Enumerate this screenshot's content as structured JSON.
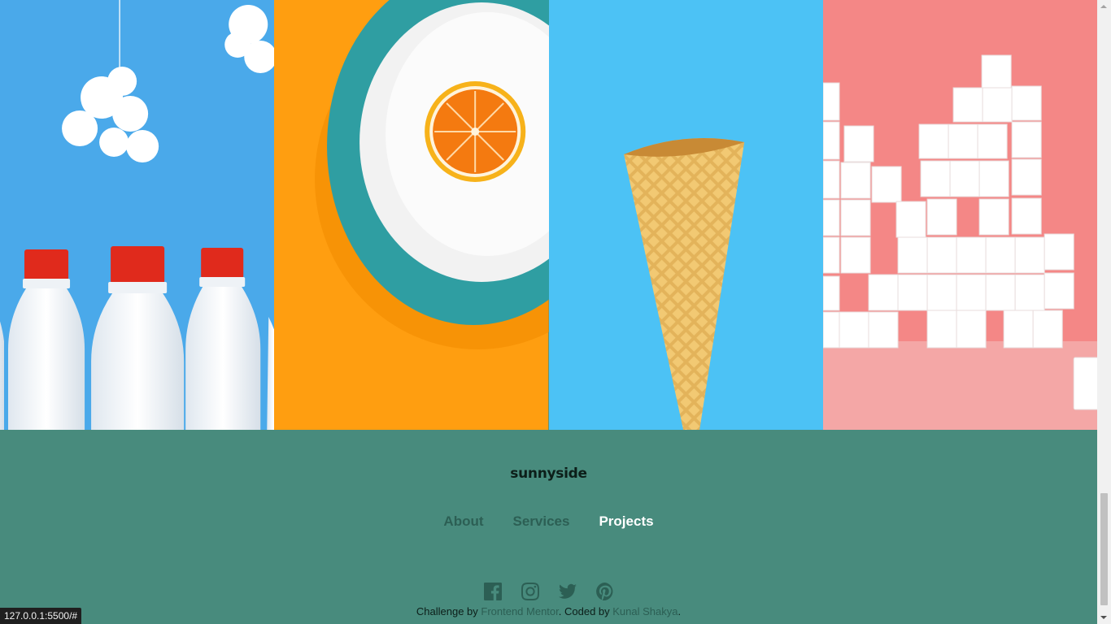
{
  "gallery": {
    "images": [
      {
        "name": "milk-bottles-image",
        "background": "#4aa9ea"
      },
      {
        "name": "orange-plate-image",
        "background": "#ff9e10"
      },
      {
        "name": "ice-cream-cone-image",
        "background": "#4cc2f5"
      },
      {
        "name": "sugar-cubes-image",
        "background": "#f48786"
      }
    ]
  },
  "footer": {
    "logo": "sunnyside",
    "nav": [
      {
        "label": "About",
        "active": false
      },
      {
        "label": "Services",
        "active": false
      },
      {
        "label": "Projects",
        "active": true
      }
    ],
    "social_icons": [
      "facebook-icon",
      "instagram-icon",
      "twitter-icon",
      "pinterest-icon"
    ],
    "credit": {
      "prefix": "Challenge by ",
      "challenge_link": "Frontend Mentor",
      "middle": ". Coded by ",
      "author_link": "Kunal Shakya",
      "suffix": "."
    },
    "colors": {
      "background": "#488b7d",
      "link": "#2c5f54",
      "active": "#ffffff"
    }
  },
  "status_bar": {
    "url": "127.0.0.1:5500/#"
  }
}
